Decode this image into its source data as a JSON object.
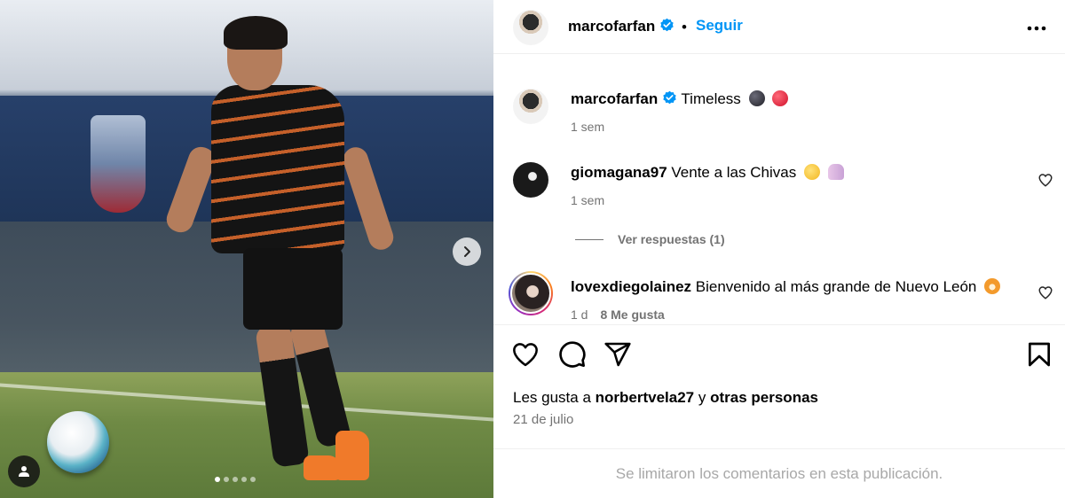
{
  "post": {
    "owner": "marcofarfan",
    "follow_label": "Seguir",
    "follow_separator": "•",
    "caption_text": "Timeless",
    "caption_time": "1 sem",
    "carousel": {
      "total": 5,
      "active": 1
    }
  },
  "comments": [
    {
      "user": "giomagana97",
      "text": "Vente a las Chivas",
      "time": "1 sem",
      "replies_label": "Ver respuestas (1)"
    },
    {
      "user": "lovexdiegolainez",
      "text": "Bienvenido al más grande de Nuevo León",
      "time": "1 d",
      "likes": "8 Me gusta"
    }
  ],
  "likes": {
    "prefix": "Les gusta a",
    "user": "norbertvela27",
    "connector": "y",
    "others": "otras personas"
  },
  "date": "21 de julio",
  "limited_notice": "Se limitaron los comentarios en esta publicación.",
  "icons": [
    "verified-badge-icon",
    "more-options-icon",
    "heart-icon",
    "comment-icon",
    "share-icon",
    "bookmark-icon",
    "chevron-right-icon",
    "user-tag-icon"
  ],
  "colors": {
    "link": "#0095f6",
    "verified": "#0095f6",
    "muted": "#737373",
    "divider": "#efefef"
  }
}
